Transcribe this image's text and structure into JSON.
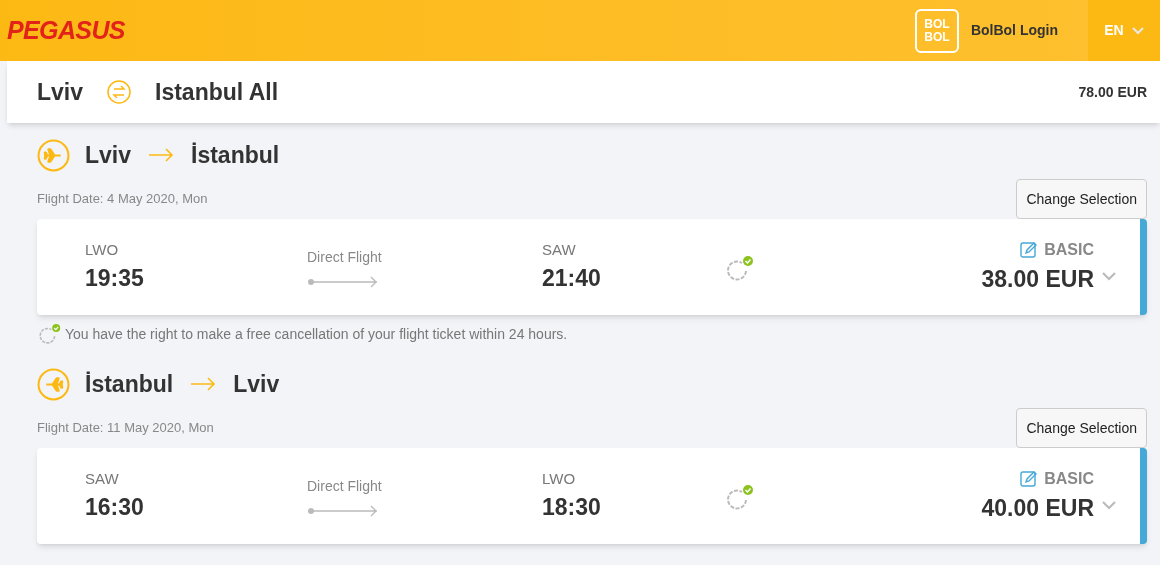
{
  "header": {
    "logo": "PEGASUS",
    "login": "BolBol Login",
    "badge": "BOL BOL",
    "language": "EN"
  },
  "summary": {
    "origin": "Lviv",
    "destination": "Istanbul All",
    "total": "78.00 EUR"
  },
  "flights": [
    {
      "kind": "outbound",
      "from": "Lviv",
      "to": "İstanbul",
      "date": "Flight Date: 4 May 2020, Mon",
      "button": "Change Selection",
      "dep_code": "LWO",
      "dep_time": "19:35",
      "type": "Direct Flight",
      "arr_code": "SAW",
      "arr_time": "21:40",
      "fare": "BASIC",
      "price": "38.00 EUR",
      "note": "You have the right to make a free cancellation of your flight ticket within 24 hours."
    },
    {
      "kind": "return",
      "from": "İstanbul",
      "to": "Lviv",
      "date": "Flight Date: 11 May 2020, Mon",
      "button": "Change Selection",
      "dep_code": "SAW",
      "dep_time": "16:30",
      "type": "Direct Flight",
      "arr_code": "LWO",
      "arr_time": "18:30",
      "fare": "BASIC",
      "price": "40.00 EUR"
    }
  ]
}
